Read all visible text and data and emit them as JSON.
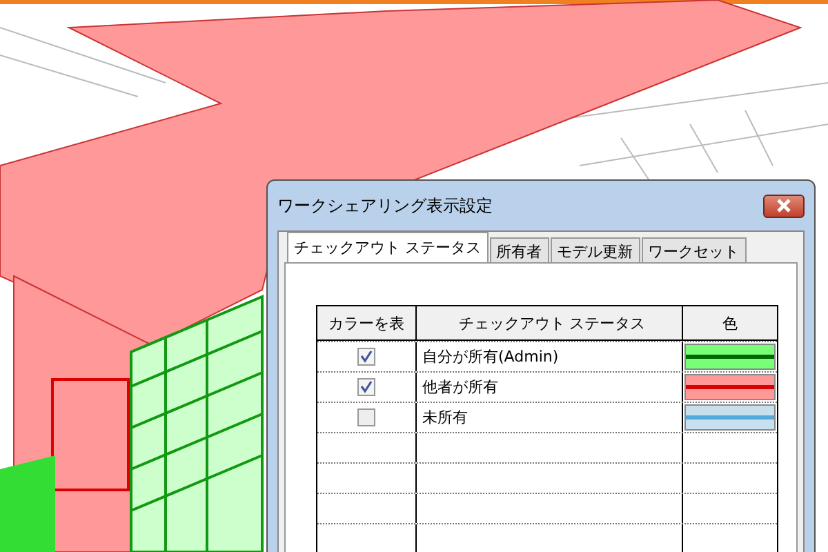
{
  "window": {
    "title": "ワークシェアリング表示設定"
  },
  "tabs": [
    {
      "label": "チェックアウト ステータス",
      "selected": true
    },
    {
      "label": "所有者",
      "selected": false
    },
    {
      "label": "モデル更新",
      "selected": false
    },
    {
      "label": "ワークセット",
      "selected": false
    }
  ],
  "table": {
    "columns": [
      "カラーを表",
      "チェックアウト ステータス",
      "色"
    ],
    "rows": [
      {
        "checked": true,
        "status": "自分が所有(Admin)",
        "color": "#77ff77",
        "line": {
          "color": "#006600"
        }
      },
      {
        "checked": true,
        "status": "他者が所有",
        "color": "#ff9999",
        "line": {
          "color": "#dd0000"
        }
      },
      {
        "checked": false,
        "status": "未所有",
        "color": "#c8e0ee",
        "line": {
          "color": "#55aadd"
        }
      }
    ]
  }
}
